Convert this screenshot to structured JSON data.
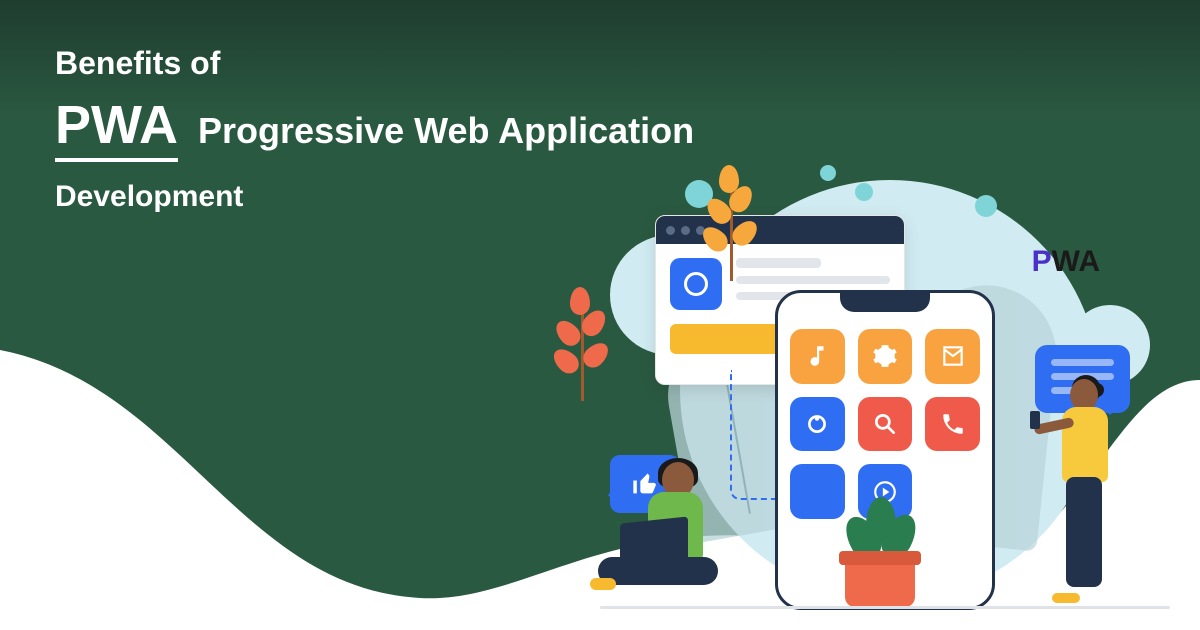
{
  "heading": {
    "line1": "Benefits of",
    "pwa": "PWA",
    "line2_rest": "Progressive Web Application",
    "line3": "Development"
  },
  "badge": {
    "p": "P",
    "wa": "WA"
  },
  "illustration": {
    "app_icons": [
      "music-icon",
      "settings-icon",
      "mail-icon",
      "logo-icon",
      "search-icon",
      "phone-icon",
      "blank-icon",
      "play-icon"
    ]
  }
}
